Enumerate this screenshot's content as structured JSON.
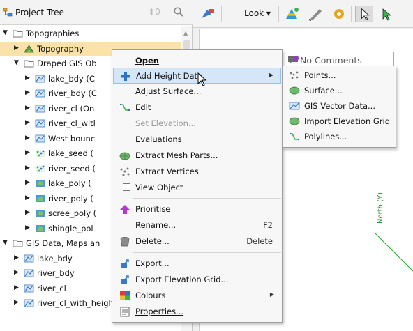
{
  "tree": {
    "title": "Project Tree",
    "sort_count": "0",
    "items": [
      {
        "label": "Topographies",
        "icon": "folder-icon",
        "expanded": true
      },
      {
        "label": "Topography",
        "icon": "topography-icon",
        "selected": true
      },
      {
        "label": "Draped GIS Ob",
        "icon": "folder-icon",
        "expanded": true
      },
      {
        "label": "lake_bdy (C",
        "icon": "gis-line-icon"
      },
      {
        "label": "river_bdy (C",
        "icon": "gis-line-icon"
      },
      {
        "label": "river_cl (On",
        "icon": "gis-line-icon"
      },
      {
        "label": "river_cl_witl",
        "icon": "gis-line-icon"
      },
      {
        "label": "West bounc",
        "icon": "gis-line-icon"
      },
      {
        "label": "lake_seed (",
        "icon": "points-icon"
      },
      {
        "label": "river_seed (",
        "icon": "points-icon"
      },
      {
        "label": "lake_poly (",
        "icon": "polygon-icon"
      },
      {
        "label": "river_poly (",
        "icon": "polygon-icon"
      },
      {
        "label": "scree_poly (",
        "icon": "polygon-icon"
      },
      {
        "label": "shingle_pol",
        "icon": "polygon-icon"
      },
      {
        "label": "GIS Data, Maps an",
        "icon": "folder-icon",
        "expanded": true
      },
      {
        "label": "lake_bdy",
        "icon": "gis-line-icon"
      },
      {
        "label": "river_bdy",
        "icon": "gis-line-icon"
      },
      {
        "label": "river_cl",
        "icon": "gis-line-icon"
      },
      {
        "label": "river_cl_with_height",
        "icon": "gis-line-icon"
      }
    ]
  },
  "toolbar": {
    "look_label": "Look ▾"
  },
  "scene": {
    "comment_label": "No Comments",
    "axis_label": "North (Y)"
  },
  "context_menu": {
    "items": [
      {
        "label": "Open",
        "bold": true
      },
      {
        "label": "Add Height Data",
        "icon": "plus-icon",
        "submenu": true,
        "hover": true
      },
      {
        "label": "Adjust Surface..."
      },
      {
        "label": "Edit",
        "icon": "edit-polyline-icon"
      },
      {
        "label": "Set Elevation...",
        "disabled": true
      },
      {
        "label": "Evaluations"
      },
      {
        "label": "Extract Mesh Parts...",
        "icon": "mesh-icon"
      },
      {
        "label": "Extract Vertices",
        "icon": "vertices-icon"
      },
      {
        "label": "View Object",
        "checkbox": true
      },
      {
        "label": "Prioritise",
        "icon": "arrow-up-icon"
      },
      {
        "label": "Rename...",
        "shortcut": "F2"
      },
      {
        "label": "Delete...",
        "shortcut": "Delete",
        "icon": "trash-icon"
      },
      {
        "label": "Export...",
        "icon": "export-icon"
      },
      {
        "label": "Export Elevation Grid...",
        "icon": "export-icon"
      },
      {
        "label": "Colours",
        "icon": "colours-icon",
        "submenu": true
      },
      {
        "label": "Properties...",
        "icon": "properties-icon"
      }
    ]
  },
  "submenu": {
    "items": [
      {
        "label": "Points...",
        "icon": "points-icon"
      },
      {
        "label": "Surface...",
        "icon": "surface-icon"
      },
      {
        "label": "GIS Vector Data...",
        "icon": "gis-line-icon"
      },
      {
        "label": "Import Elevation Grid",
        "icon": "surface-icon"
      },
      {
        "label": "Polylines...",
        "icon": "polyline-icon"
      }
    ]
  },
  "colors": {
    "selection": "#fbe3a8",
    "menu_hover": "#d5e6f8",
    "accent_green": "#1db11d"
  }
}
